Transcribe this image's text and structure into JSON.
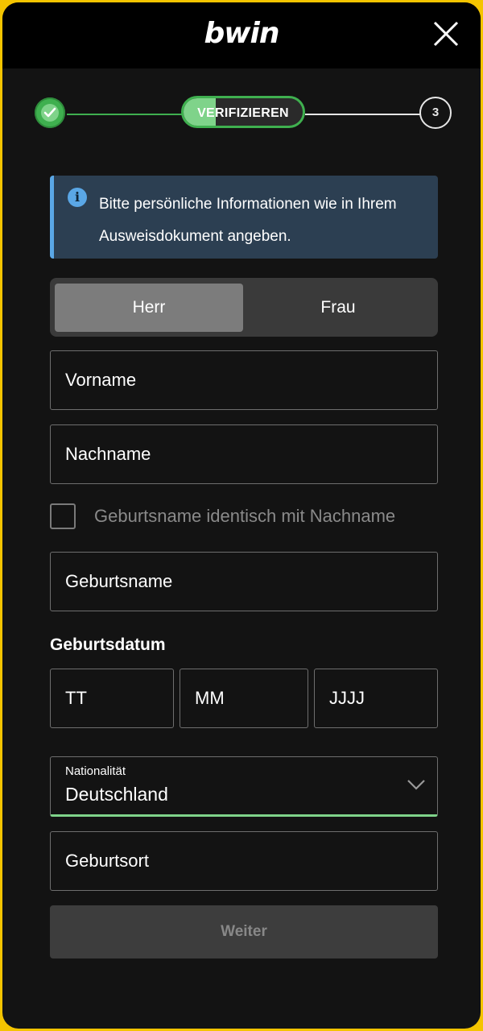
{
  "header": {
    "logo_text": "bwin",
    "brand_color": "#ffd100"
  },
  "stepper": {
    "active_label": "VERIFIZIEREN",
    "step3_label": "3",
    "done_color": "#3fb04f"
  },
  "info": {
    "icon_glyph": "i",
    "text": "Bitte persönliche Informationen wie in Ihrem Ausweisdokument angeben."
  },
  "gender": {
    "options": [
      "Herr",
      "Frau"
    ],
    "selected": "Herr"
  },
  "form": {
    "first_name_placeholder": "Vorname",
    "last_name_placeholder": "Nachname",
    "birthname_same_label": "Geburtsname identisch mit Nachname",
    "birthname_placeholder": "Geburtsname",
    "dob_label": "Geburtsdatum",
    "dob_day_placeholder": "TT",
    "dob_month_placeholder": "MM",
    "dob_year_placeholder": "JJJJ",
    "nationality_label": "Nationalität",
    "nationality_value": "Deutschland",
    "birthplace_placeholder": "Geburtsort",
    "submit_label": "Weiter"
  }
}
